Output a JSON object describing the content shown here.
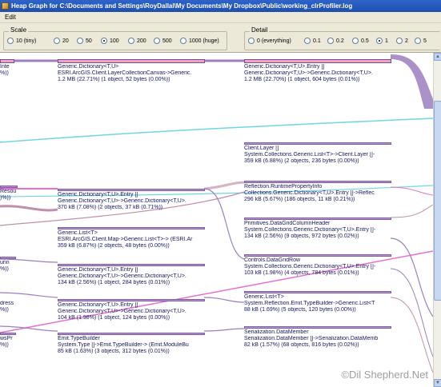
{
  "window": {
    "title": "Heap Graph for C:\\Documents and Settings\\RoyDallal\\My Documents\\My Dropbox\\Public\\working_clrProfiler.log"
  },
  "menu": {
    "edit": "Edit"
  },
  "scale": {
    "label": "Scale",
    "options": [
      "10 (tiny)",
      "20",
      "50",
      "100",
      "200",
      "500",
      "1000 (huge)"
    ],
    "selected": "100"
  },
  "detail": {
    "label": "Detail",
    "options": [
      "0 (everything)",
      "0.1",
      "0.2",
      "0.5",
      "1",
      "2",
      "5"
    ],
    "selected": "1"
  },
  "colors": {
    "node_bar": "#f3a3b9",
    "node_border": "#6f4fa0",
    "flow_purple": "#9b7fc0",
    "flow_cyan": "#6fd7df",
    "flow_pink": "#e66fd0",
    "flow_mauve": "#c08fa8",
    "titlebar": "#2e63c8"
  },
  "left_column": [
    {
      "l1": "Inte",
      "l2": "%))"
    },
    {
      "l1": "Resou",
      "l2": ")%))"
    },
    {
      "l1": "unn",
      "l2": "%))"
    },
    {
      "l1": "dress",
      "l2": "%))"
    },
    {
      "l1": "wsPr",
      "l2": "%))"
    }
  ],
  "middle_column": [
    {
      "l1": "Generic.Dictionary<T,U>",
      "l2": "ESRI.ArcGIS.Client.LayerCollectionCanvas->Generic.",
      "l3": "1.2 MB    (22.71%)  (1 object,   52 bytes (0.00%))"
    },
    {
      "l1": "Generic.Dictionary<T,U>.Entry []",
      "l2": "Generic.Dictionary<T,U>->Generic.Dictionary<T,U>.",
      "l3": "370 kB    (7.08%)  (2 objects,   37 kB    (0.71%))"
    },
    {
      "l1": "Generic.List<T>",
      "l2": "ESRI.ArcGIS.Client.Map->Generic.List<T>-> (ESRI.Ar",
      "l3": "359 kB    (6.87%)  (2 objects,   48 bytes (0.00%))"
    },
    {
      "l1": "Generic.Dictionary<T,U>.Entry []",
      "l2": "Generic.Dictionary<T,U>->Generic.Dictionary<T,U>.",
      "l3": "134 kB    (2.56%)  (1 object,  284 bytes (0.01%))"
    },
    {
      "l1": "Generic.Dictionary<T,U>.Entry []",
      "l2": "Generic.Dictionary<T,U>->Generic.Dictionary<T,U>.",
      "l3": "104 kB    (1.98%)  (1 object,  124 bytes (0.00%))"
    },
    {
      "l1": "Emit.TypeBuilder",
      "l2": "System.Type  []->Emit.TypeBuilder-> (Emit.ModuleBu",
      "l3": "85 kB    (1.63%)  (3 objects,  312 bytes (0.01%))"
    }
  ],
  "right_column": [
    {
      "l1": "Generic.Dictionary<T,U>.Entry []",
      "l2": "Generic.Dictionary<T,U>->Generic.Dictionary<T,U>.",
      "l3": "1.2 MB    (22.70%)  (1 object,  604 bytes (0.01%))"
    },
    {
      "l1": "Client.Layer []",
      "l2": "System.Collections.Generic.List<T>->Client.Layer []-",
      "l3": "359 kB    (6.88%)  (2 objects,  236 bytes (0.00%))"
    },
    {
      "l1": "Reflection.RuntimePropertyInfo",
      "l2": "Collections.Generic.Dictionary<T,U>.Entry  []->Reflec",
      "l3": "296 kB    (5.67%)  (186 objects,   11 kB    (0.21%))"
    },
    {
      "l1": "Primitives.DataGridColumnHeader",
      "l2": "System.Collections.Generic.Dictionary<T,U>.Entry []-",
      "l3": "134 kB    (2.56%)  (9 objects,  972 bytes (0.02%))"
    },
    {
      "l1": "Controls.DataGridRow",
      "l2": "System.Collections.Generic.Dictionary<T,U>.Entry []-",
      "l3": "103 kB    (1.98%)  (4 objects,  784 bytes (0.01%))"
    },
    {
      "l1": "Generic.List<T>",
      "l2": "System.Reflection.Emit.TypeBuilder->Generic.List<T",
      "l3": "88 kB    (1.69%)  (5 objects,  120 bytes (0.00%))"
    },
    {
      "l1": "Serialization.DataMember",
      "l2": "Serialization.DataMember  []->Serialization.DataMemb",
      "l3": "82 kB    (1.57%)  (68 objects,  816 bytes (0.02%))"
    }
  ],
  "watermark": "©Dil Shepherd.Net"
}
